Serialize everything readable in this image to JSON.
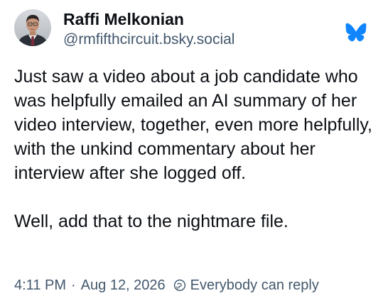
{
  "author": {
    "display_name": "Raffi Melkonian",
    "handle": "@rmfifthcircuit.bsky.social"
  },
  "post": {
    "paragraphs": [
      "Just saw a video about a job candidate who was helpfully emailed an AI summary of her video interview, together, even more helpfully, with the unkind commentary about her interview after she logged off.",
      "Well, add that to the nightmare file."
    ]
  },
  "meta": {
    "time": "4:11 PM",
    "separator": "·",
    "date": "Aug 12, 2026",
    "reply_setting": "Everybody can reply"
  },
  "icons": {
    "logo": "bluesky-butterfly-icon",
    "reply": "globe-reply-icon"
  },
  "colors": {
    "brand": "#1185fe",
    "text": "#0b0f14",
    "muted": "#42576c"
  }
}
